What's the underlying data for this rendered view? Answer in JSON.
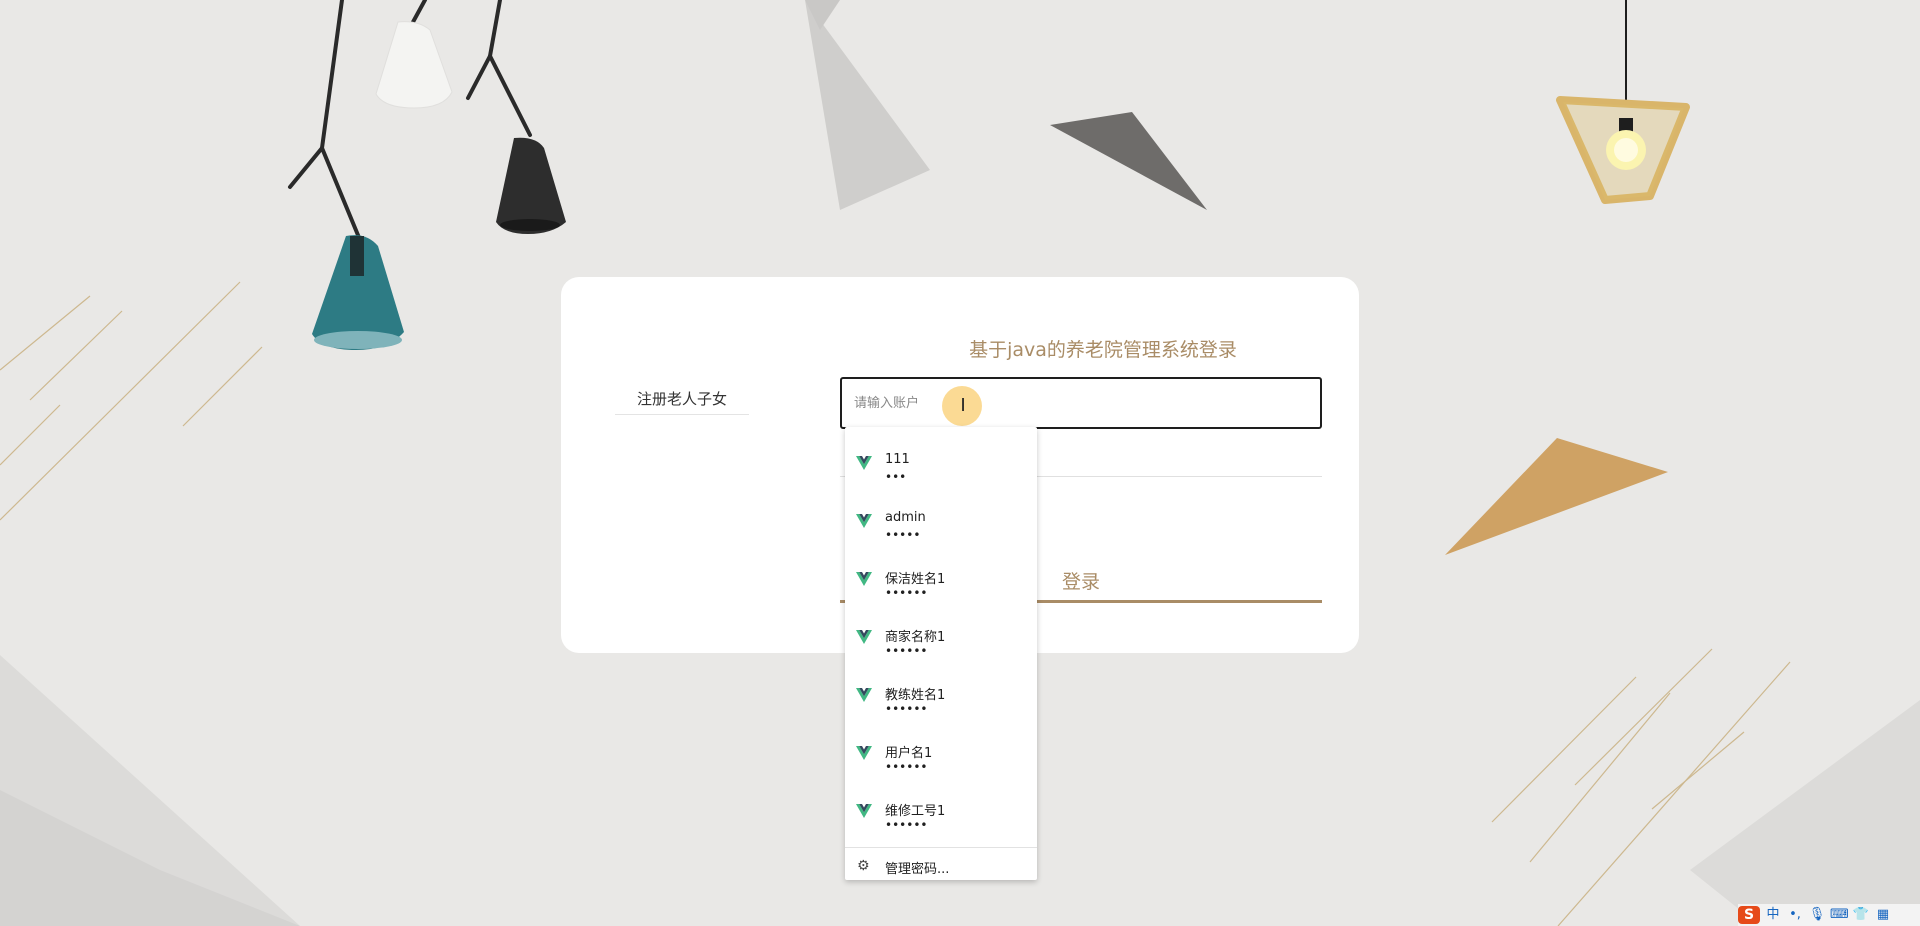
{
  "login": {
    "title": "基于java的养老院管理系统登录",
    "register_link": "注册老人子女",
    "account_placeholder": "请输入账户",
    "login_button": "登录"
  },
  "autofill": {
    "items": [
      {
        "user": "111",
        "pass": "•••"
      },
      {
        "user": "admin",
        "pass": "•••••"
      },
      {
        "user": "保洁姓名1",
        "pass": "••••••"
      },
      {
        "user": "商家名称1",
        "pass": "••••••"
      },
      {
        "user": "教练姓名1",
        "pass": "••••••"
      },
      {
        "user": "用户名1",
        "pass": "••••••"
      },
      {
        "user": "维修工号1",
        "pass": "••••••"
      }
    ],
    "manage_label": "管理密码..."
  },
  "ime_tray": {
    "logo": "S",
    "mode": "中"
  },
  "colors": {
    "accent": "#a98c66",
    "background": "#e9e8e6",
    "vue_green": "#41b883",
    "vue_dark": "#34495e"
  }
}
